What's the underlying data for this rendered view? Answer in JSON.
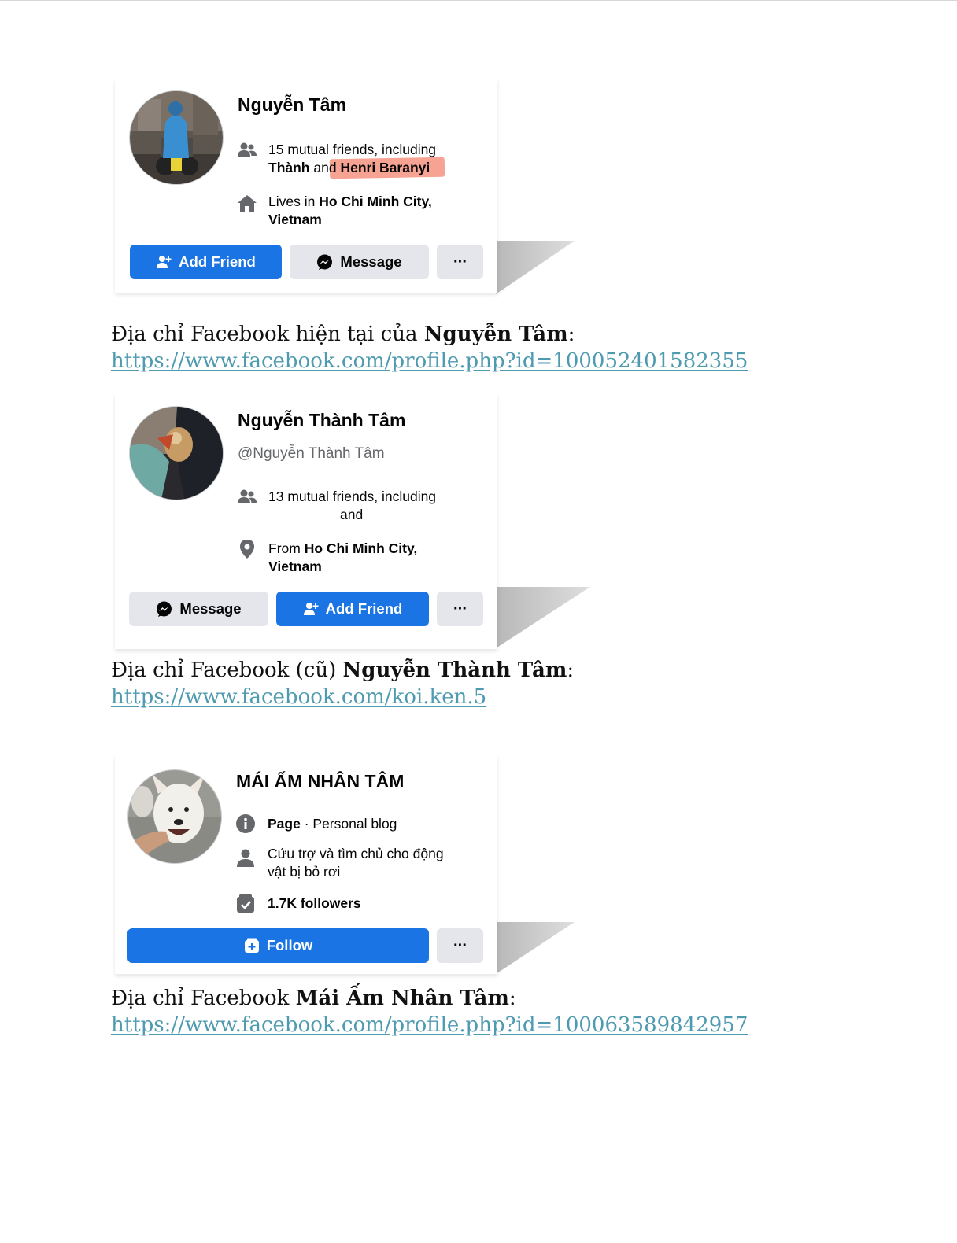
{
  "profiles": [
    {
      "name": "Nguyễn Tâm",
      "mutual_line1": "15 mutual friends, including",
      "mutual_line2_a": "Thành",
      "mutual_line2_b": "and",
      "mutual_line2_c": "Henri Baranyi",
      "lives_prefix": "Lives in",
      "lives_city": "Ho Chi Minh City,",
      "lives_country": "Vietnam",
      "add_friend": "Add Friend",
      "message": "Message",
      "more": "···",
      "highlight_color": "#f6a394"
    },
    {
      "name": "Nguyễn Thành Tâm",
      "handle": "@Nguyễn Thành Tâm",
      "mutual_line1": "13 mutual friends, including",
      "mutual_line2": "and",
      "from_prefix": "From",
      "from_city": "Ho Chi Minh City,",
      "from_country": "Vietnam",
      "message": "Message",
      "add_friend": "Add Friend",
      "more": "···"
    },
    {
      "name": "MÁI ẤM NHÂN TÂM",
      "page_label": "Page",
      "page_category": "· Personal blog",
      "description": "Cứu trợ và tìm chủ cho động vật bị bỏ rơi",
      "followers": "1.7K followers",
      "follow": "Follow",
      "more": "···"
    }
  ],
  "captions": [
    {
      "prefix": "Địa chỉ Facebook hiện tại của",
      "name": "Nguyễn Tâm",
      "suffix": ":",
      "url": "https://www.facebook.com/profile.php?id=100052401582355"
    },
    {
      "prefix": "Địa chỉ Facebook (cũ)",
      "name": "Nguyễn Thành Tâm",
      "suffix": ":",
      "url": "https://www.facebook.com/koi.ken.5"
    },
    {
      "prefix": "Địa chỉ Facebook",
      "name": "Mái Ấm Nhân Tâm",
      "suffix": ":",
      "url": "https://www.facebook.com/profile.php?id=100063589842957"
    }
  ],
  "colors": {
    "facebook_blue": "#1b74e4",
    "button_gray": "#e4e6eb",
    "link": "#4e9ab0"
  }
}
